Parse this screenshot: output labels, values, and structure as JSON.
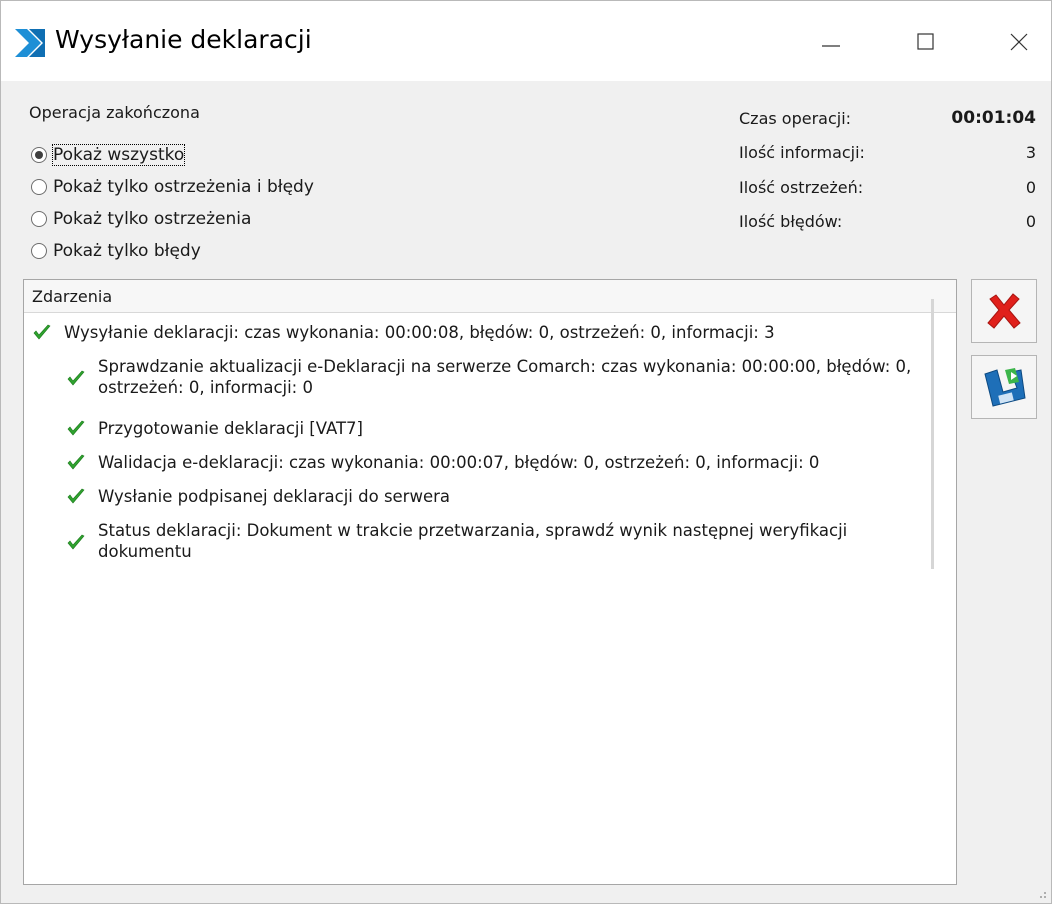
{
  "window": {
    "title": "Wysyłanie deklaracji"
  },
  "status": {
    "text": "Operacja zakończona"
  },
  "filters": [
    {
      "label": "Pokaż wszystko",
      "checked": true
    },
    {
      "label": "Pokaż tylko ostrzeżenia i błędy",
      "checked": false
    },
    {
      "label": "Pokaż tylko ostrzeżenia",
      "checked": false
    },
    {
      "label": "Pokaż tylko błędy",
      "checked": false
    }
  ],
  "stats": {
    "time_label": "Czas operacji:",
    "time_value": "00:01:04",
    "info_label": "Ilość informacji:",
    "info_value": "3",
    "warn_label": "Ilość ostrzeżeń:",
    "warn_value": "0",
    "error_label": "Ilość błędów:",
    "error_value": "0"
  },
  "events": {
    "header": "Zdarzenia",
    "root": "Wysyłanie deklaracji: czas wykonania: 00:00:08, błędów: 0, ostrzeżeń: 0, informacji: 3",
    "children": [
      "Sprawdzanie aktualizacji e-Deklaracji na serwerze Comarch: czas wykonania: 00:00:00, błędów: 0, ostrzeżeń: 0, informacji: 0",
      "Przygotowanie deklaracji [VAT7]",
      "Walidacja e-deklaracji: czas wykonania: 00:00:07, błędów: 0, ostrzeżeń: 0, informacji: 0",
      "Wysłanie podpisanej deklaracji do serwera",
      "Status deklaracji: Dokument w trakcie przetwarzania, sprawdź wynik następnej weryfikacji dokumentu"
    ]
  },
  "icons": {
    "check": "check-icon",
    "cancel": "red-x-icon",
    "save": "floppy-save-icon"
  },
  "colors": {
    "check_green": "#2fa32f",
    "cancel_red": "#e0201b",
    "logo_blue": "#1e8fd6"
  }
}
